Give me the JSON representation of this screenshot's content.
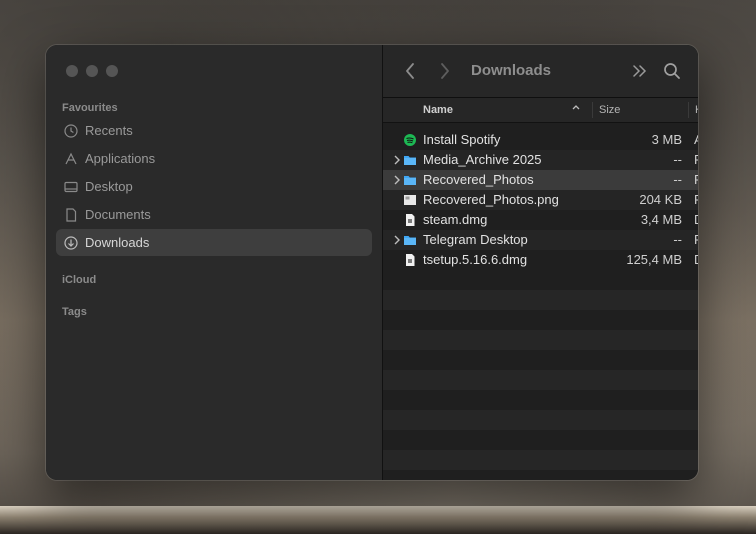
{
  "window": {
    "title": "Downloads"
  },
  "sidebar": {
    "favourites_title": "Favourites",
    "items": [
      {
        "label": "Recents",
        "icon": "clock-icon"
      },
      {
        "label": "Applications",
        "icon": "applications-icon"
      },
      {
        "label": "Desktop",
        "icon": "desktop-icon"
      },
      {
        "label": "Documents",
        "icon": "document-icon"
      },
      {
        "label": "Downloads",
        "icon": "download-icon",
        "active": true
      }
    ],
    "icloud_title": "iCloud",
    "tags_title": "Tags"
  },
  "columns": {
    "name": "Name",
    "size": "Size",
    "kind": "K"
  },
  "files": [
    {
      "name": "Install Spotify",
      "size": "3 MB",
      "kind": "A",
      "type": "app",
      "folder": false
    },
    {
      "name": "Media_Archive 2025",
      "size": "--",
      "kind": "F",
      "type": "folder",
      "folder": true
    },
    {
      "name": "Recovered_Photos",
      "size": "--",
      "kind": "F",
      "type": "folder",
      "folder": true,
      "selected": true
    },
    {
      "name": "Recovered_Photos.png",
      "size": "204 KB",
      "kind": "P",
      "type": "image",
      "folder": false
    },
    {
      "name": "steam.dmg",
      "size": "3,4 MB",
      "kind": "D",
      "type": "dmg",
      "folder": false
    },
    {
      "name": "Telegram Desktop",
      "size": "--",
      "kind": "F",
      "type": "folder",
      "folder": true
    },
    {
      "name": "tsetup.5.16.6.dmg",
      "size": "125,4 MB",
      "kind": "D",
      "type": "dmg",
      "folder": false
    }
  ],
  "colors": {
    "folder": "#3fa7f5",
    "spotify": "#1db954",
    "selection": "#3b3b3b"
  }
}
